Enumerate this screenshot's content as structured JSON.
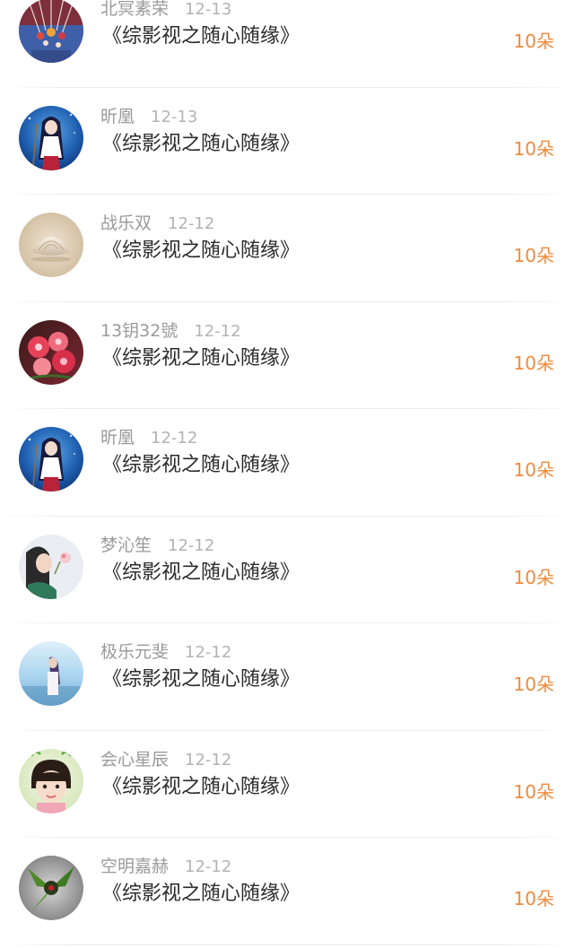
{
  "gift_list": {
    "items": [
      {
        "name": "北冥素荣",
        "date": "12-13",
        "title": "《综影视之随心随缘》",
        "gift": "10朵",
        "avatar": "necklace-avatar"
      },
      {
        "name": "昕凰",
        "date": "12-13",
        "title": "《综影视之随心随缘》",
        "gift": "10朵",
        "avatar": "anime-girl-avatar"
      },
      {
        "name": "战乐双",
        "date": "12-12",
        "title": "《综影视之随心随缘》",
        "gift": "10朵",
        "avatar": "seashell-avatar"
      },
      {
        "name": "13钥32號",
        "date": "12-12",
        "title": "《综影视之随心随缘》",
        "gift": "10朵",
        "avatar": "flowers-avatar"
      },
      {
        "name": "昕凰",
        "date": "12-12",
        "title": "《综影视之随心随缘》",
        "gift": "10朵",
        "avatar": "anime-girl-avatar"
      },
      {
        "name": "梦沁笙",
        "date": "12-12",
        "title": "《综影视之随心随缘》",
        "gift": "10朵",
        "avatar": "girl-with-flower-avatar"
      },
      {
        "name": "极乐元斐",
        "date": "12-12",
        "title": "《综影视之随心随缘》",
        "gift": "10朵",
        "avatar": "girl-by-sea-avatar"
      },
      {
        "name": "会心星辰",
        "date": "12-12",
        "title": "《综影视之随心随缘》",
        "gift": "10朵",
        "avatar": "child-portrait-avatar"
      },
      {
        "name": "空明嘉赫",
        "date": "12-12",
        "title": "《综影视之随心随缘》",
        "gift": "10朵",
        "avatar": "green-creature-avatar"
      }
    ]
  },
  "colors": {
    "name_text": "#9a9a9a",
    "date_text": "#b3b3b3",
    "title_text": "#2b2b2b",
    "gift_accent": "#f08a3c",
    "divider": "#ececec",
    "background": "#ffffff"
  }
}
